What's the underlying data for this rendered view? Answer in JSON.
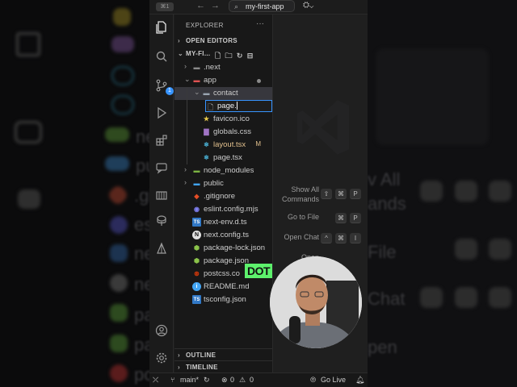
{
  "titlebar": {
    "badge": "⌘1",
    "search_text": "my-first-app"
  },
  "activity": {
    "scm_badge": "1"
  },
  "explorer": {
    "title": "EXPLORER",
    "open_editors": "OPEN EDITORS",
    "project": "MY-FI...",
    "rename_value": "page.",
    "tree": [
      {
        "label": ".next",
        "type": "folder",
        "depth": 1,
        "chev": "›",
        "icon_color": "#8a8a8a"
      },
      {
        "label": "app",
        "type": "folder",
        "depth": 1,
        "chev": "⌄",
        "icon_color": "#e05252",
        "modified_dot": true
      },
      {
        "label": "contact",
        "type": "folder",
        "depth": 2,
        "chev": "⌄",
        "icon_color": "#9aa5b1",
        "selected": true
      },
      {
        "label": "favicon.ico",
        "type": "star",
        "depth": 2,
        "icon_color": "#e6c84a"
      },
      {
        "label": "globals.css",
        "type": "css",
        "depth": 2,
        "icon_color": "#a074c4"
      },
      {
        "label": "layout.tsx",
        "type": "react",
        "depth": 2,
        "icon_color": "#4fc1e9",
        "modified": true,
        "mark": "M"
      },
      {
        "label": "page.tsx",
        "type": "react",
        "depth": 2,
        "icon_color": "#4fc1e9"
      },
      {
        "label": "node_modules",
        "type": "folder",
        "depth": 1,
        "chev": "›",
        "icon_color": "#7cb342"
      },
      {
        "label": "public",
        "type": "folder",
        "depth": 1,
        "chev": "›",
        "icon_color": "#42a5f5"
      },
      {
        "label": ".gitignore",
        "type": "git",
        "depth": 1,
        "icon_color": "#e44d26"
      },
      {
        "label": "eslint.config.mjs",
        "type": "eslint",
        "depth": 1,
        "icon_color": "#8080f2"
      },
      {
        "label": "next-env.d.ts",
        "type": "ts",
        "depth": 1,
        "icon_color": "#3178c6"
      },
      {
        "label": "next.config.ts",
        "type": "next",
        "depth": 1,
        "icon_color": "#e0e0e0"
      },
      {
        "label": "package-lock.json",
        "type": "node",
        "depth": 1,
        "icon_color": "#8bc34a"
      },
      {
        "label": "package.json",
        "type": "node",
        "depth": 1,
        "icon_color": "#8bc34a"
      },
      {
        "label": "postcss.co",
        "type": "postcss",
        "depth": 1,
        "icon_color": "#dd3a0a"
      },
      {
        "label": "README.md",
        "type": "info",
        "depth": 1,
        "icon_color": "#42a5f5"
      },
      {
        "label": "tsconfig.json",
        "type": "ts",
        "depth": 1,
        "icon_color": "#3178c6"
      }
    ],
    "outline": "OUTLINE",
    "timeline": "TIMELINE"
  },
  "editor": {
    "shortcuts": [
      {
        "label_lines": [
          "Show All",
          "Commands"
        ],
        "keys": [
          "⇧",
          "⌘",
          "P"
        ]
      },
      {
        "label_lines": [
          "Go to File"
        ],
        "keys": [
          "⌘",
          "P"
        ]
      },
      {
        "label_lines": [
          "Open Chat"
        ],
        "keys": [
          "^",
          "⌘",
          "I"
        ]
      },
      {
        "label_lines": [
          "Open"
        ],
        "keys": []
      }
    ]
  },
  "statusbar": {
    "branch": "main*",
    "errors": "0",
    "warnings": "0",
    "golive": "Go Live"
  },
  "overlay": {
    "caption": "DOT"
  },
  "background": {
    "left_texts": [
      "ne",
      "pu",
      ".gi",
      "es",
      "ne",
      "ne",
      "pa",
      "pa",
      "po"
    ],
    "right_texts": [
      "v All",
      "ands",
      "File",
      "Chat",
      "pen"
    ]
  },
  "colors": {
    "accent": "#3794ff",
    "selection": "#37373d",
    "modified": "#e2c08d",
    "caption_bg": "#5df26c"
  }
}
